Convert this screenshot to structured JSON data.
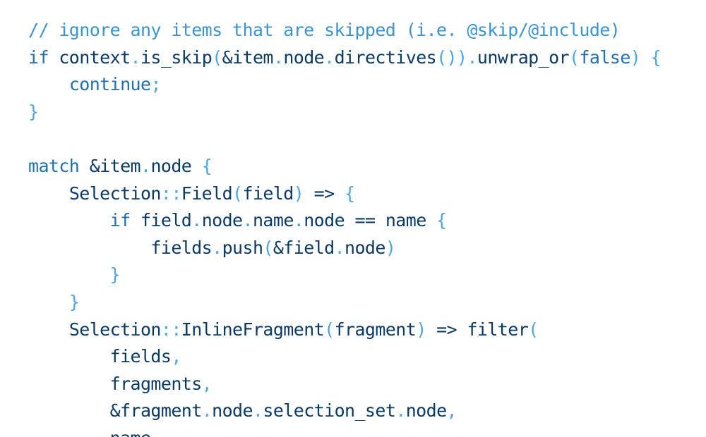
{
  "colors": {
    "background": "#ffffff",
    "comment": "#3a93d4",
    "keyword": "#1f6fb2",
    "identifier": "#0b3a66",
    "punctuation": "#4aa6e6"
  },
  "code": {
    "language": "rust",
    "lines": [
      [
        {
          "t": "comment",
          "v": "// ignore any items that are skipped (i.e. @skip/@include)"
        }
      ],
      [
        {
          "t": "keyword",
          "v": "if"
        },
        {
          "t": "text",
          "v": " "
        },
        {
          "t": "ident",
          "v": "context"
        },
        {
          "t": "punct",
          "v": "."
        },
        {
          "t": "ident",
          "v": "is_skip"
        },
        {
          "t": "punct",
          "v": "("
        },
        {
          "t": "ident",
          "v": "&item"
        },
        {
          "t": "punct",
          "v": "."
        },
        {
          "t": "ident",
          "v": "node"
        },
        {
          "t": "punct",
          "v": "."
        },
        {
          "t": "ident",
          "v": "directives"
        },
        {
          "t": "punct",
          "v": "())"
        },
        {
          "t": "punct",
          "v": "."
        },
        {
          "t": "ident",
          "v": "unwrap_or"
        },
        {
          "t": "punct",
          "v": "("
        },
        {
          "t": "keyword",
          "v": "false"
        },
        {
          "t": "punct",
          "v": ")"
        },
        {
          "t": "text",
          "v": " "
        },
        {
          "t": "punct",
          "v": "{"
        }
      ],
      [
        {
          "t": "text",
          "v": "    "
        },
        {
          "t": "keyword",
          "v": "continue"
        },
        {
          "t": "punct",
          "v": ";"
        }
      ],
      [
        {
          "t": "punct",
          "v": "}"
        }
      ],
      [],
      [
        {
          "t": "keyword",
          "v": "match"
        },
        {
          "t": "text",
          "v": " "
        },
        {
          "t": "ident",
          "v": "&item"
        },
        {
          "t": "punct",
          "v": "."
        },
        {
          "t": "ident",
          "v": "node"
        },
        {
          "t": "text",
          "v": " "
        },
        {
          "t": "punct",
          "v": "{"
        }
      ],
      [
        {
          "t": "text",
          "v": "    "
        },
        {
          "t": "ident",
          "v": "Selection"
        },
        {
          "t": "punct",
          "v": "::"
        },
        {
          "t": "ident",
          "v": "Field"
        },
        {
          "t": "punct",
          "v": "("
        },
        {
          "t": "ident",
          "v": "field"
        },
        {
          "t": "punct",
          "v": ")"
        },
        {
          "t": "text",
          "v": " "
        },
        {
          "t": "ident",
          "v": "=>"
        },
        {
          "t": "text",
          "v": " "
        },
        {
          "t": "punct",
          "v": "{"
        }
      ],
      [
        {
          "t": "text",
          "v": "        "
        },
        {
          "t": "keyword",
          "v": "if"
        },
        {
          "t": "text",
          "v": " "
        },
        {
          "t": "ident",
          "v": "field"
        },
        {
          "t": "punct",
          "v": "."
        },
        {
          "t": "ident",
          "v": "node"
        },
        {
          "t": "punct",
          "v": "."
        },
        {
          "t": "ident",
          "v": "name"
        },
        {
          "t": "punct",
          "v": "."
        },
        {
          "t": "ident",
          "v": "node"
        },
        {
          "t": "text",
          "v": " "
        },
        {
          "t": "ident",
          "v": "=="
        },
        {
          "t": "text",
          "v": " "
        },
        {
          "t": "ident",
          "v": "name"
        },
        {
          "t": "text",
          "v": " "
        },
        {
          "t": "punct",
          "v": "{"
        }
      ],
      [
        {
          "t": "text",
          "v": "            "
        },
        {
          "t": "ident",
          "v": "fields"
        },
        {
          "t": "punct",
          "v": "."
        },
        {
          "t": "ident",
          "v": "push"
        },
        {
          "t": "punct",
          "v": "("
        },
        {
          "t": "ident",
          "v": "&field"
        },
        {
          "t": "punct",
          "v": "."
        },
        {
          "t": "ident",
          "v": "node"
        },
        {
          "t": "punct",
          "v": ")"
        }
      ],
      [
        {
          "t": "text",
          "v": "        "
        },
        {
          "t": "punct",
          "v": "}"
        }
      ],
      [
        {
          "t": "text",
          "v": "    "
        },
        {
          "t": "punct",
          "v": "}"
        }
      ],
      [
        {
          "t": "text",
          "v": "    "
        },
        {
          "t": "ident",
          "v": "Selection"
        },
        {
          "t": "punct",
          "v": "::"
        },
        {
          "t": "ident",
          "v": "InlineFragment"
        },
        {
          "t": "punct",
          "v": "("
        },
        {
          "t": "ident",
          "v": "fragment"
        },
        {
          "t": "punct",
          "v": ")"
        },
        {
          "t": "text",
          "v": " "
        },
        {
          "t": "ident",
          "v": "=>"
        },
        {
          "t": "text",
          "v": " "
        },
        {
          "t": "ident",
          "v": "filter"
        },
        {
          "t": "punct",
          "v": "("
        }
      ],
      [
        {
          "t": "text",
          "v": "        "
        },
        {
          "t": "ident",
          "v": "fields"
        },
        {
          "t": "punct",
          "v": ","
        }
      ],
      [
        {
          "t": "text",
          "v": "        "
        },
        {
          "t": "ident",
          "v": "fragments"
        },
        {
          "t": "punct",
          "v": ","
        }
      ],
      [
        {
          "t": "text",
          "v": "        "
        },
        {
          "t": "ident",
          "v": "&fragment"
        },
        {
          "t": "punct",
          "v": "."
        },
        {
          "t": "ident",
          "v": "node"
        },
        {
          "t": "punct",
          "v": "."
        },
        {
          "t": "ident",
          "v": "selection_set"
        },
        {
          "t": "punct",
          "v": "."
        },
        {
          "t": "ident",
          "v": "node"
        },
        {
          "t": "punct",
          "v": ","
        }
      ],
      [
        {
          "t": "text",
          "v": "        "
        },
        {
          "t": "ident",
          "v": "name"
        }
      ]
    ]
  }
}
